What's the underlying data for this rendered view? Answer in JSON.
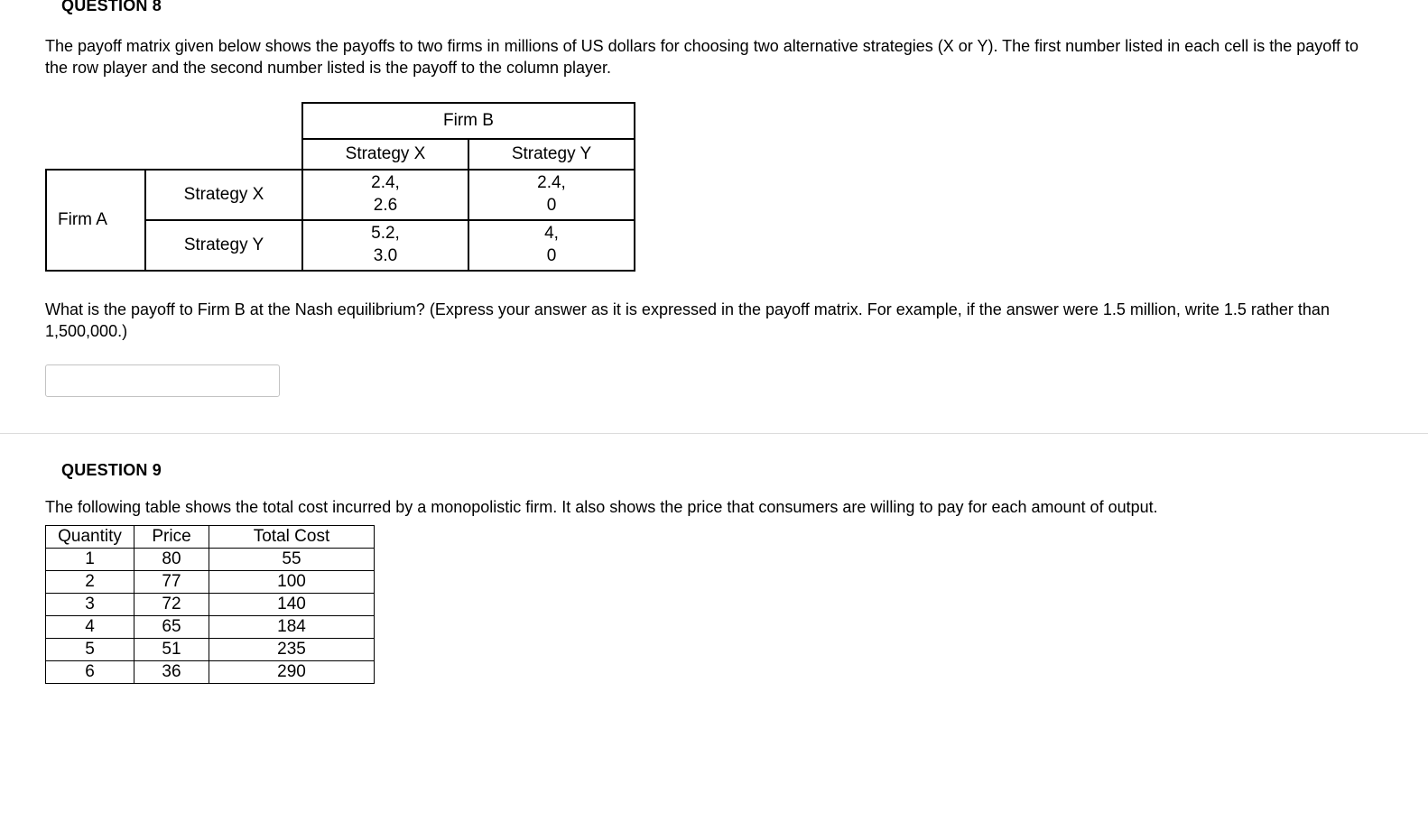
{
  "q8": {
    "heading": "QUESTION 8",
    "intro": "The payoff matrix given below shows the payoffs to two firms in millions of US dollars for choosing two alternative strategies (X or Y). The first number listed in each cell is the payoff to the row player and the second number listed is the payoff to the column player.",
    "firm_b_label": "Firm B",
    "firm_a_label": "Firm A",
    "col_headers": [
      "Strategy X",
      "Strategy Y"
    ],
    "row_headers": [
      "Strategy X",
      "Strategy Y"
    ],
    "cells": {
      "xx_top": "2.4,",
      "xx_bot": "2.6",
      "xy_top": "2.4,",
      "xy_bot": "0",
      "yx_top": "5.2,",
      "yx_bot": "3.0",
      "yy_top": "4,",
      "yy_bot": "0"
    },
    "question": "What is the payoff to Firm B at the Nash equilibrium? (Express your answer as it is expressed in the payoff matrix. For example, if the answer were 1.5 million, write 1.5 rather than 1,500,000.)",
    "answer_value": ""
  },
  "q9": {
    "heading": "QUESTION 9",
    "intro": "The following table shows the total cost incurred by a monopolistic firm. It also shows the price that consumers are willing to pay for each amount of output.",
    "columns": [
      "Quantity",
      "Price",
      "Total Cost"
    ],
    "rows": [
      {
        "q": "1",
        "p": "80",
        "tc": "55"
      },
      {
        "q": "2",
        "p": "77",
        "tc": "100"
      },
      {
        "q": "3",
        "p": "72",
        "tc": "140"
      },
      {
        "q": "4",
        "p": "65",
        "tc": "184"
      },
      {
        "q": "5",
        "p": "51",
        "tc": "235"
      },
      {
        "q": "6",
        "p": "36",
        "tc": "290"
      }
    ]
  },
  "chart_data": [
    {
      "type": "table",
      "title": "Payoff matrix (row payoff, column payoff)",
      "row_player": "Firm A",
      "col_player": "Firm B",
      "row_strategies": [
        "Strategy X",
        "Strategy Y"
      ],
      "col_strategies": [
        "Strategy X",
        "Strategy Y"
      ],
      "payoffs": [
        [
          [
            2.4,
            2.6
          ],
          [
            2.4,
            0
          ]
        ],
        [
          [
            5.2,
            3.0
          ],
          [
            4,
            0
          ]
        ]
      ]
    },
    {
      "type": "table",
      "title": "Monopolistic firm cost and demand",
      "columns": [
        "Quantity",
        "Price",
        "Total Cost"
      ],
      "data": [
        [
          1,
          80,
          55
        ],
        [
          2,
          77,
          100
        ],
        [
          3,
          72,
          140
        ],
        [
          4,
          65,
          184
        ],
        [
          5,
          51,
          235
        ],
        [
          6,
          36,
          290
        ]
      ]
    }
  ]
}
